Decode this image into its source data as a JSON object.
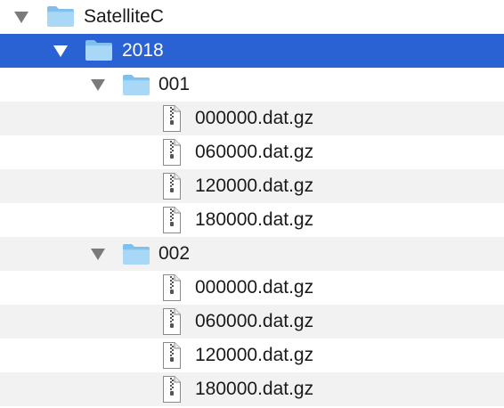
{
  "tree": {
    "root": {
      "label": "SatelliteC",
      "icon": "folder-icon"
    },
    "year": {
      "label": "2018",
      "icon": "folder-icon",
      "selected": true
    },
    "folders": [
      {
        "label": "001",
        "files": [
          "000000.dat.gz",
          "060000.dat.gz",
          "120000.dat.gz",
          "180000.dat.gz"
        ]
      },
      {
        "label": "002",
        "files": [
          "000000.dat.gz",
          "060000.dat.gz",
          "120000.dat.gz",
          "180000.dat.gz"
        ]
      }
    ]
  },
  "colors": {
    "selection": "#2b62d3",
    "stripe": "#f2f2f2",
    "folder_light": "#a9d7f6",
    "folder_dark": "#7fbfee"
  },
  "icons": {
    "disclosure": "disclosure-triangle-icon",
    "folder": "folder-icon",
    "file": "zip-file-icon"
  }
}
